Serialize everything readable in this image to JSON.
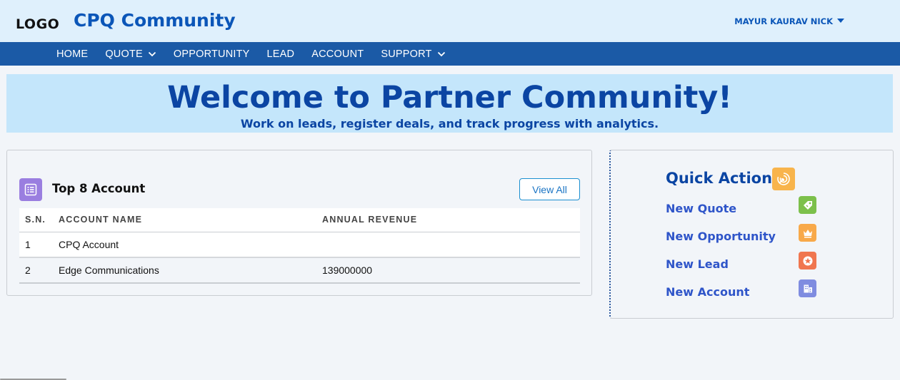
{
  "header": {
    "logo": "LOGO",
    "app_title": "CPQ Community",
    "user_name": "MAYUR KAURAV NICK"
  },
  "nav": {
    "items": [
      {
        "label": "HOME",
        "dropdown": false
      },
      {
        "label": "QUOTE",
        "dropdown": true
      },
      {
        "label": "OPPORTUNITY",
        "dropdown": false
      },
      {
        "label": "LEAD",
        "dropdown": false
      },
      {
        "label": "ACCOUNT",
        "dropdown": false
      },
      {
        "label": "SUPPORT",
        "dropdown": true
      }
    ]
  },
  "banner": {
    "title": "Welcome to Partner Community!",
    "subtitle": "Work on leads, register deals, and track progress with analytics."
  },
  "accounts": {
    "title": "Top 8 Account",
    "view_all": "View All",
    "columns": [
      "S.N.",
      "ACCOUNT NAME",
      "ANNUAL REVENUE"
    ],
    "rows": [
      {
        "sn": "1",
        "name": "CPQ Account",
        "revenue": ""
      },
      {
        "sn": "2",
        "name": "Edge Communications",
        "revenue": "139000000"
      }
    ]
  },
  "quick_action": {
    "title": "Quick Action",
    "actions": [
      {
        "label": "New Quote",
        "icon": "tag-icon",
        "color": "#7cc04b"
      },
      {
        "label": "New Opportunity",
        "icon": "crown-icon",
        "color": "#f8a94a"
      },
      {
        "label": "New Lead",
        "icon": "lead-star-icon",
        "color": "#f0764f"
      },
      {
        "label": "New Account",
        "icon": "building-icon",
        "color": "#7f8ce0"
      }
    ]
  },
  "colors": {
    "header_bg": "#dff0fc",
    "nav_bg": "#1b5aa6",
    "brand_blue": "#0b56b8",
    "banner_bg": "#c4e6fb"
  }
}
